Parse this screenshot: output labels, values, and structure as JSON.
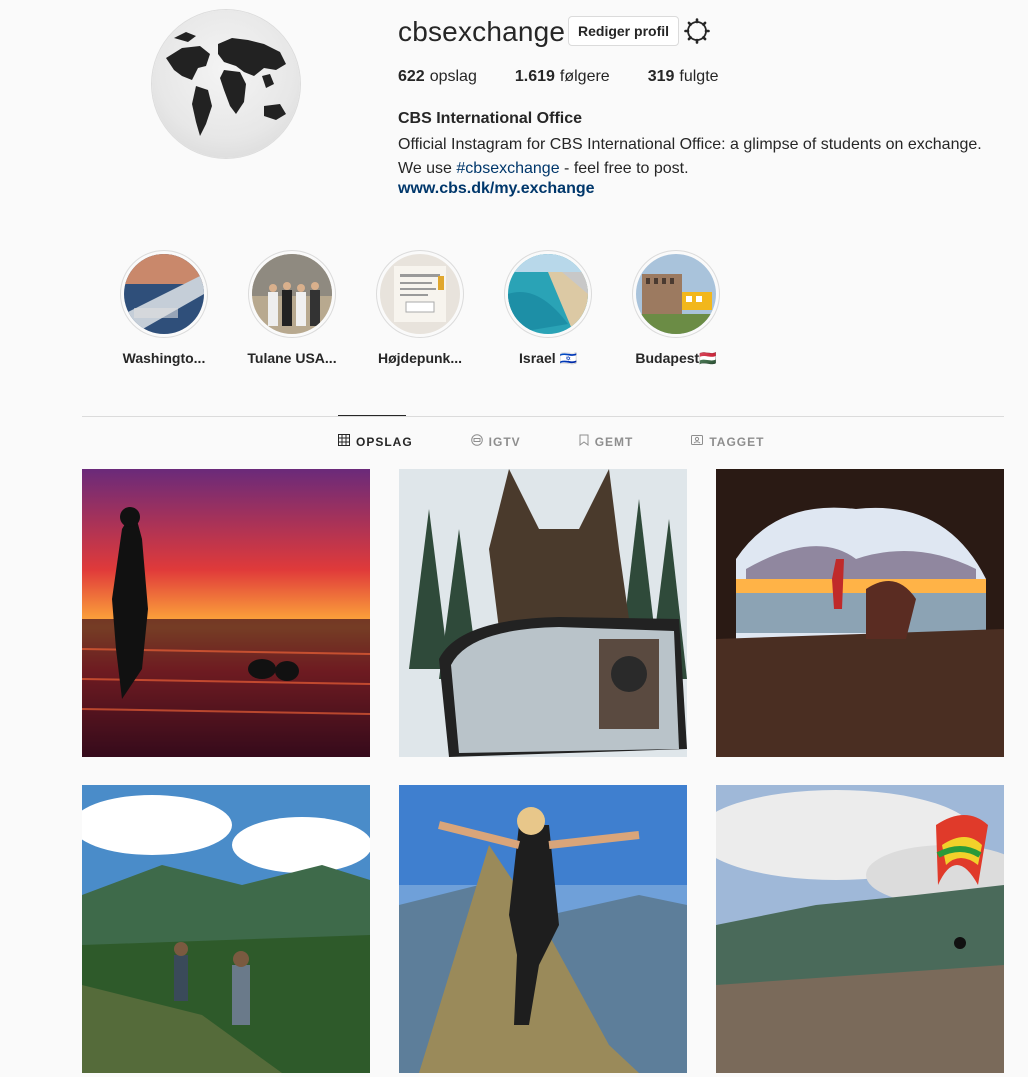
{
  "profile": {
    "username": "cbsexchange",
    "edit_label": "Rediger profil",
    "posts_count": "622",
    "posts_label": "opslag",
    "followers_count": "1.619",
    "followers_label": "følgere",
    "following_count": "319",
    "following_label": "fulgte",
    "full_name": "CBS International Office",
    "bio_part1": "Official Instagram for CBS International Office: a glimpse of students on exchange. We use ",
    "bio_hashtag": "#cbsexchange",
    "bio_part2": " - feel free to post.",
    "website": "www.cbs.dk/my.exchange"
  },
  "highlights": [
    {
      "label": "Washingto..."
    },
    {
      "label": "Tulane USA..."
    },
    {
      "label": "Højdepunk..."
    },
    {
      "label": "Israel 🇮🇱"
    },
    {
      "label": "Budapest🇭🇺"
    }
  ],
  "tabs": [
    {
      "label": "OPSLAG",
      "icon": "grid-icon",
      "active": true
    },
    {
      "label": "IGTV",
      "icon": "igtv-icon",
      "active": false
    },
    {
      "label": "GEMT",
      "icon": "bookmark-icon",
      "active": false
    },
    {
      "label": "TAGGET",
      "icon": "tagged-icon",
      "active": false
    }
  ],
  "colors": {
    "link": "#00376b",
    "border": "#dbdbdb",
    "muted": "#8e8e8e"
  }
}
